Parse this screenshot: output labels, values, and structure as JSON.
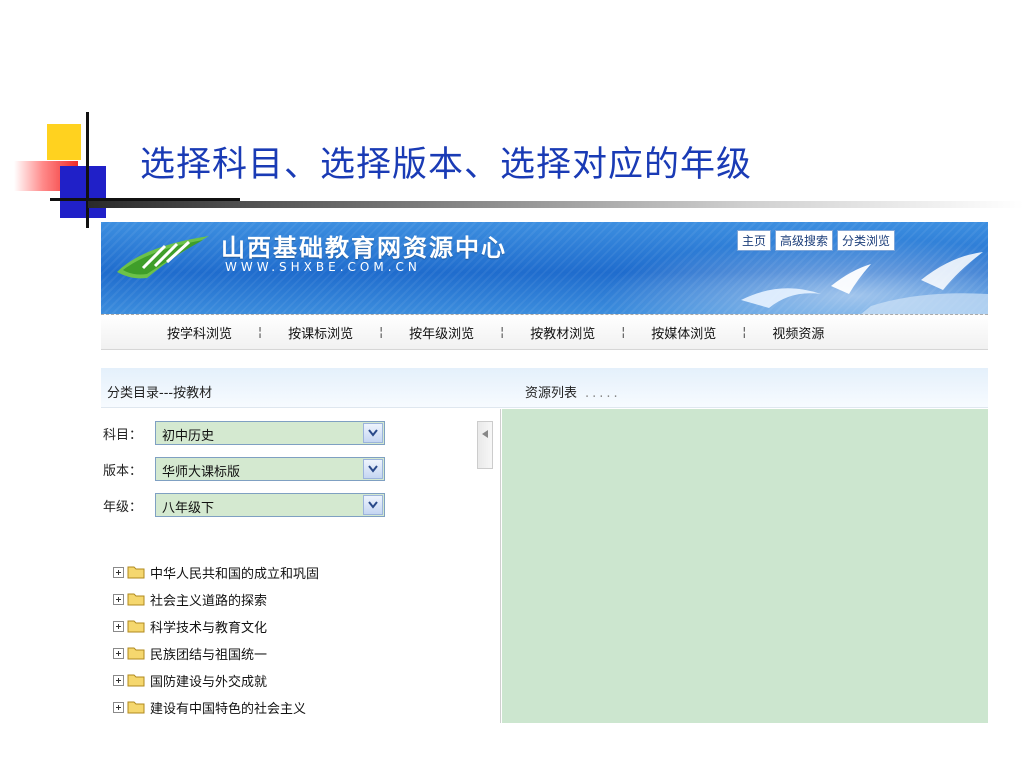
{
  "slide": {
    "title": "选择科目、选择版本、选择对应的年级"
  },
  "site": {
    "name": "山西基础教育网资源中心",
    "url": "WWW.SHXBE.COM.CN",
    "top_links": [
      "主页",
      "高级搜索",
      "分类浏览"
    ]
  },
  "nav": {
    "items": [
      "按学科浏览",
      "按课标浏览",
      "按年级浏览",
      "按教材浏览",
      "按媒体浏览",
      "视频资源"
    ],
    "separator": "¦"
  },
  "panels": {
    "left_header": "分类目录---按教材",
    "right_header": "资源列表",
    "right_header_dots": "....."
  },
  "filters": {
    "subject": {
      "label": "科目：",
      "value": "初中历史"
    },
    "edition": {
      "label": "版本：",
      "value": "华师大课标版"
    },
    "grade": {
      "label": "年级：",
      "value": "八年级下"
    }
  },
  "tree": {
    "items": [
      "中华人民共和国的成立和巩固",
      "社会主义道路的探索",
      "科学技术与教育文化",
      "民族团结与祖国统一",
      "国防建设与外交成就",
      "建设有中国特色的社会主义"
    ]
  },
  "icons": {
    "dropdown": "chevron-down-icon",
    "tree_expand": "plus-box-icon",
    "folder": "folder-icon",
    "collapse": "triangle-left-icon"
  },
  "colors": {
    "title": "#1a3bb5",
    "banner": "#1f6ccd",
    "select_bg": "#d4e9d0",
    "content_bg": "#cce6cf",
    "folder": "#f5d76e"
  }
}
